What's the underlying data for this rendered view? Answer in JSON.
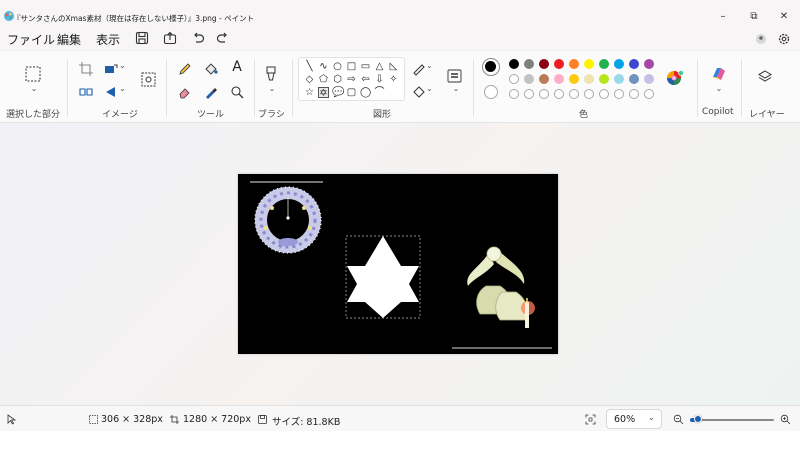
{
  "window": {
    "title": "『サンタさんのXmas素材（現在は存在しない様子）』3.png - ペイント",
    "minimize_glyph": "–",
    "restore_glyph": "⧉",
    "close_glyph": "✕"
  },
  "menu": {
    "file": "ファイル",
    "edit": "編集",
    "view": "表示"
  },
  "ribbon": {
    "groups": {
      "selection": "選択した部分",
      "image": "イメージ",
      "tools": "ツール",
      "brush": "ブラシ",
      "shapes": "図形",
      "colors": "色",
      "copilot": "Copilot",
      "layers": "レイヤー"
    },
    "text_tool_glyph": "A",
    "shape_glyphs": [
      "╲",
      "∿",
      "○",
      "□",
      "▭",
      "△",
      "◺",
      "◇",
      "⬠",
      "⬡",
      "⇨",
      "⇦",
      "⇩",
      "✧",
      "☆",
      "✡",
      "💬",
      "▢",
      "◯",
      "⌒"
    ],
    "colors_row1": [
      "#000000",
      "#7f7f7f",
      "#880015",
      "#ed1c24",
      "#ff7f27",
      "#fff200",
      "#22b14c",
      "#00a2e8",
      "#3f48cc",
      "#a349a4"
    ],
    "colors_row2": [
      "#ffffff",
      "#c3c3c3",
      "#b97a57",
      "#ffaec9",
      "#ffc90e",
      "#efe4b0",
      "#b5e61d",
      "#99d9ea",
      "#7092be",
      "#c8bfe7"
    ],
    "primary_color": "#000000",
    "secondary_color": "#ffffff"
  },
  "status": {
    "selection_size": "306 × 328px",
    "canvas_size": "1280 × 720px",
    "file_size": "サイズ: 81.8KB",
    "zoom": "60%",
    "zoom_fraction": 0.1
  }
}
